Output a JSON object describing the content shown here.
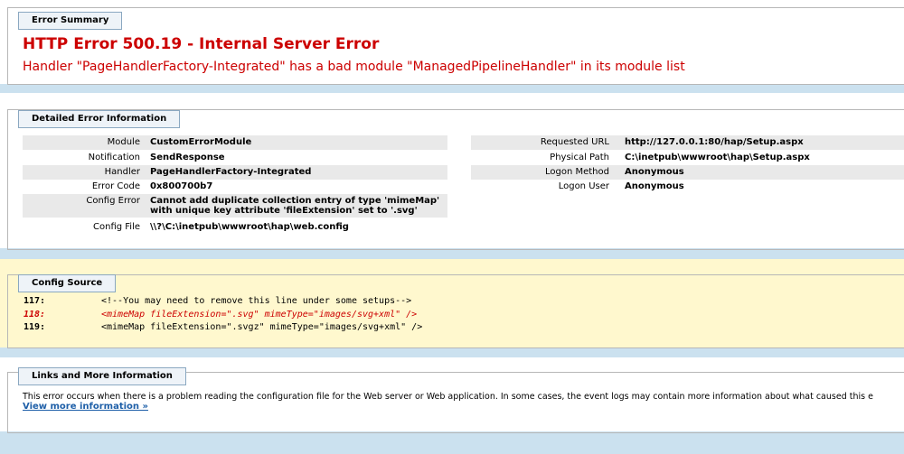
{
  "error_summary": {
    "legend": "Error Summary",
    "title": "HTTP Error 500.19 - Internal Server Error",
    "message": "Handler \"PageHandlerFactory-Integrated\" has a bad module \"ManagedPipelineHandler\" in its module list"
  },
  "detailed": {
    "legend": "Detailed Error Information",
    "left": [
      {
        "label": "Module",
        "value": "CustomErrorModule"
      },
      {
        "label": "Notification",
        "value": "SendResponse"
      },
      {
        "label": "Handler",
        "value": "PageHandlerFactory-Integrated"
      },
      {
        "label": "Error Code",
        "value": "0x800700b7"
      },
      {
        "label": "Config Error",
        "value": "Cannot add duplicate collection entry of type 'mimeMap'",
        "value2": "with unique key attribute 'fileExtension' set to '.svg'"
      },
      {
        "label": "Config File",
        "value": "\\\\?\\C:\\inetpub\\wwwroot\\hap\\web.config"
      }
    ],
    "right": [
      {
        "label": "Requested URL",
        "value": "http://127.0.0.1:80/hap/Setup.aspx"
      },
      {
        "label": "Physical Path",
        "value": "C:\\inetpub\\wwwroot\\hap\\Setup.aspx"
      },
      {
        "label": "Logon Method",
        "value": "Anonymous"
      },
      {
        "label": "Logon User",
        "value": "Anonymous"
      }
    ]
  },
  "config_source": {
    "legend": "Config Source",
    "lines": [
      {
        "num": "117:",
        "text": "<!--You may need to remove this line under some setups-->"
      },
      {
        "num": "118:",
        "text": "<mimeMap fileExtension=\".svg\" mimeType=\"images/svg+xml\" />"
      },
      {
        "num": "119:",
        "text": "<mimeMap fileExtension=\".svgz\" mimeType=\"images/svg+xml\" />"
      }
    ]
  },
  "links": {
    "legend": "Links and More Information",
    "text": "This error occurs when there is a problem reading the configuration file for the Web server or Web application. In some cases, the event logs may contain more information about what caused this e",
    "link": "View more information »"
  },
  "colors": {
    "error_red": "#CC0000",
    "page_bg": "#CBE1EF",
    "config_bg": "#FFF8CE",
    "link_blue": "#1E5FA8"
  }
}
